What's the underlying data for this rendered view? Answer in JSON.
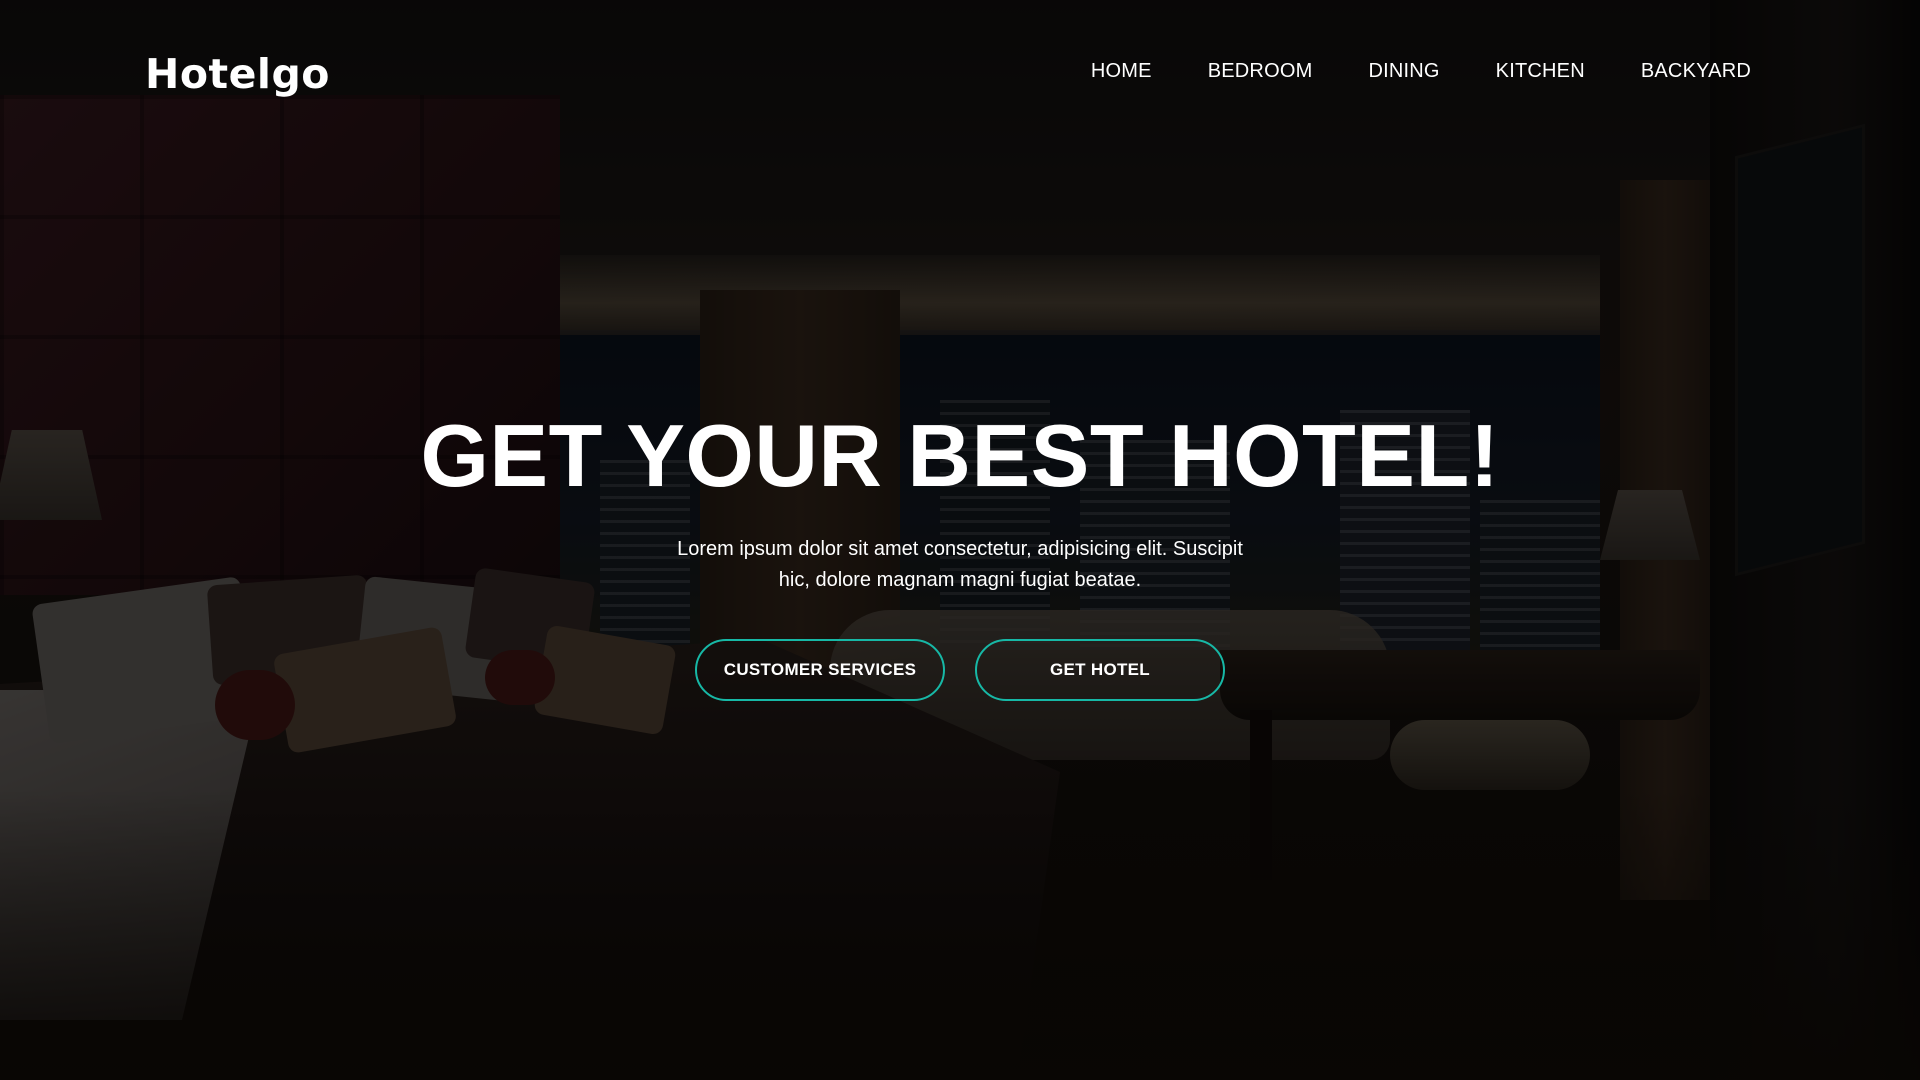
{
  "brand": {
    "logo": "Hotelgo"
  },
  "nav": {
    "items": [
      {
        "label": "HOME"
      },
      {
        "label": "BEDROOM"
      },
      {
        "label": "DINING"
      },
      {
        "label": "KITCHEN"
      },
      {
        "label": "BACKYARD"
      }
    ]
  },
  "hero": {
    "headline": "GET YOUR BEST HOTEL!",
    "subtext": "Lorem ipsum dolor sit amet consectetur, adipisicing elit. Suscipit hic, dolore magnam magni fugiat beatae.",
    "buttons": {
      "primary": "CUSTOMER SERVICES",
      "secondary": "GET HOTEL"
    },
    "background_image": "hotel-bedroom-night-photo"
  },
  "colors": {
    "accent": "#17b8a6",
    "text": "#ffffff",
    "overlay": "#000000"
  }
}
